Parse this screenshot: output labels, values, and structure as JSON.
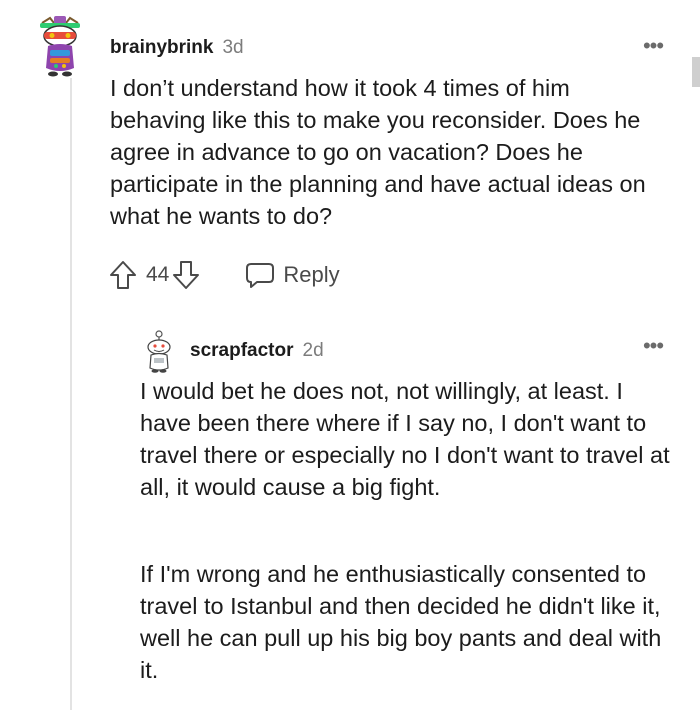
{
  "comment": {
    "username": "brainybrink",
    "age": "3d",
    "more_label": "•••",
    "body": "I don’t understand how it took 4 times of him behaving like this to make you reconsider. Does he agree in advance to go on vacation? Does he participate in the planning and have actual ideas on what he wants to do?",
    "vote_count": "44",
    "reply_label": "Reply",
    "icons": {
      "avatar": "avatar-snoo",
      "upvote": "arrow-up-outline-icon",
      "downvote": "arrow-down-outline-icon",
      "reply": "speech-bubble-icon",
      "more": "more-horizontal-icon"
    }
  },
  "reply": {
    "username": "scrapfactor",
    "age": "2d",
    "more_label": "•••",
    "paragraphs": [
      "I would bet he does not, not willingly, at least. I have been there where if I say no, I don't want to travel there or especially no I don't want to travel at all, it would cause a big fight.",
      "If I'm wrong and he enthusiastically consented to travel to Istanbul and then decided he didn't like it, well he can pull up his big boy pants and deal with it."
    ]
  },
  "colors": {
    "text_primary": "#1c1c1c",
    "text_meta": "#7c7c7c",
    "action_gray": "#4a4a4a",
    "thread_line": "#e3e3e3",
    "background": "#ffffff"
  }
}
